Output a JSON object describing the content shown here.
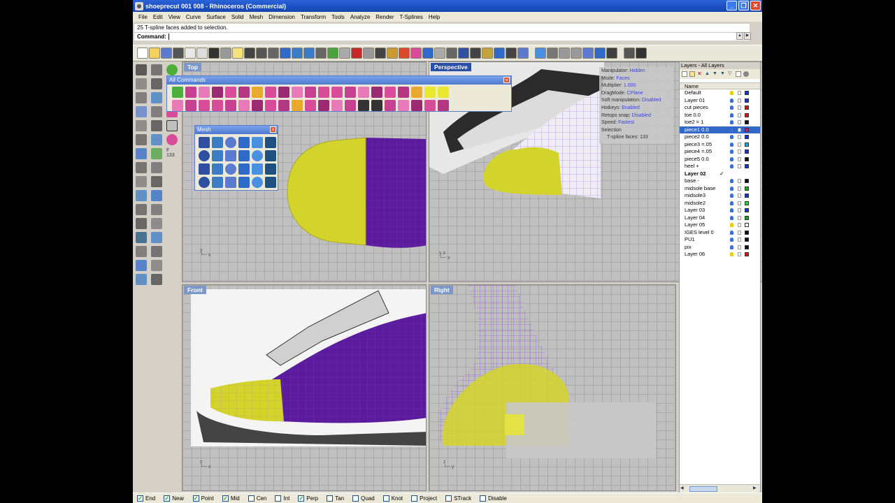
{
  "window": {
    "title": "shoeprecut 001 008 - Rhinoceros (Commercial)"
  },
  "menu": [
    "File",
    "Edit",
    "View",
    "Curve",
    "Surface",
    "Solid",
    "Mesh",
    "Dimension",
    "Transform",
    "Tools",
    "Analyze",
    "Render",
    "T-Splines",
    "Help"
  ],
  "command": {
    "history": "25 T-spline faces added to selection.",
    "prompt": "Command:"
  },
  "left_tb2_numbers": {
    "f": "F",
    "n": "133"
  },
  "viewports": {
    "top": "Top",
    "perspective": "Perspective",
    "front": "Front",
    "right": "Right"
  },
  "floating": {
    "all_commands": "All Commands",
    "mesh": "Mesh"
  },
  "hud": [
    {
      "k": "Manipulator:",
      "v": "Hidden"
    },
    {
      "k": "Mode:",
      "v": "Faces"
    },
    {
      "k": "Multiplier:",
      "v": "1.000"
    },
    {
      "k": "DragMode:",
      "v": "CPlane"
    },
    {
      "k": "Soft manipulation:",
      "v": "Disabled"
    },
    {
      "k": "Hotkeys:",
      "v": "Enabled"
    },
    {
      "k": "Retopo snap:",
      "v": "Disabled"
    },
    {
      "k": "Speed:",
      "v": "Fastest"
    },
    {
      "k": "Selection",
      "v": ""
    },
    {
      "k": "T-spline faces:",
      "v": "133"
    }
  ],
  "layers": {
    "title": "Layers - All Layers",
    "column": "Name",
    "items": [
      {
        "name": "Default",
        "color": "#1530d8",
        "bulb": "#e8d000"
      },
      {
        "name": "Layer 01",
        "color": "#1530d8",
        "bulb": "#3b6fd8"
      },
      {
        "name": "cut pieces",
        "color": "#d81515",
        "bulb": "#3b6fd8"
      },
      {
        "name": "toe 0.0",
        "color": "#d81515",
        "bulb": "#3b6fd8"
      },
      {
        "name": "toe2 = 1",
        "color": "#111111",
        "bulb": "#3b6fd8"
      },
      {
        "name": "piece1 0.0",
        "color": "#d81584",
        "bulb": "#3b6fd8",
        "selected": true
      },
      {
        "name": "piece2 0.0",
        "color": "#1530d8",
        "bulb": "#3b6fd8"
      },
      {
        "name": "piece3 =.05",
        "color": "#15b0d8",
        "bulb": "#3b6fd8"
      },
      {
        "name": "piece4 =.05",
        "color": "#1530d8",
        "bulb": "#3b6fd8"
      },
      {
        "name": "piece5 0.0",
        "color": "#111111",
        "bulb": "#3b6fd8"
      },
      {
        "name": "heel +",
        "color": "#1530d8",
        "bulb": "#3b6fd8"
      },
      {
        "name": "Layer 02",
        "color": "#ffffff",
        "bulb": "#ffffff",
        "current": true
      },
      {
        "name": "base -",
        "color": "#111111",
        "bulb": "#3b6fd8"
      },
      {
        "name": "midsole base",
        "color": "#1aa81a",
        "bulb": "#3b6fd8"
      },
      {
        "name": "midsole3",
        "color": "#1530d8",
        "bulb": "#3b6fd8"
      },
      {
        "name": "midsole2",
        "color": "#2bd82b",
        "bulb": "#3b6fd8"
      },
      {
        "name": "Layer 03",
        "color": "#1530d8",
        "bulb": "#3b6fd8"
      },
      {
        "name": "Layer 04",
        "color": "#1aa81a",
        "bulb": "#3b6fd8"
      },
      {
        "name": "Layer 05",
        "color": "#ffffff",
        "bulb": "#e8d000"
      },
      {
        "name": "IGES level 0",
        "color": "#111111",
        "bulb": "#3b6fd8"
      },
      {
        "name": "PU1",
        "color": "#111111",
        "bulb": "#3b6fd8"
      },
      {
        "name": "pix",
        "color": "#111111",
        "bulb": "#3b6fd8"
      },
      {
        "name": "Layer 06",
        "color": "#d81515",
        "bulb": "#e8d000"
      }
    ]
  },
  "osnaps": [
    {
      "label": "End",
      "checked": true
    },
    {
      "label": "Near",
      "checked": true
    },
    {
      "label": "Point",
      "checked": true
    },
    {
      "label": "Mid",
      "checked": true
    },
    {
      "label": "Cen",
      "checked": false
    },
    {
      "label": "Int",
      "checked": false
    },
    {
      "label": "Perp",
      "checked": true
    },
    {
      "label": "Tan",
      "checked": false
    },
    {
      "label": "Quad",
      "checked": false
    },
    {
      "label": "Knot",
      "checked": false
    },
    {
      "label": "Project",
      "checked": false
    },
    {
      "label": "STrack",
      "checked": false
    },
    {
      "label": "Disable",
      "checked": false
    }
  ],
  "colors": {
    "yellow": "#d8d62a",
    "purple": "#5a1fa0",
    "mesh_line": "#9a3fe0",
    "title_blue": "#1a4fc1"
  }
}
